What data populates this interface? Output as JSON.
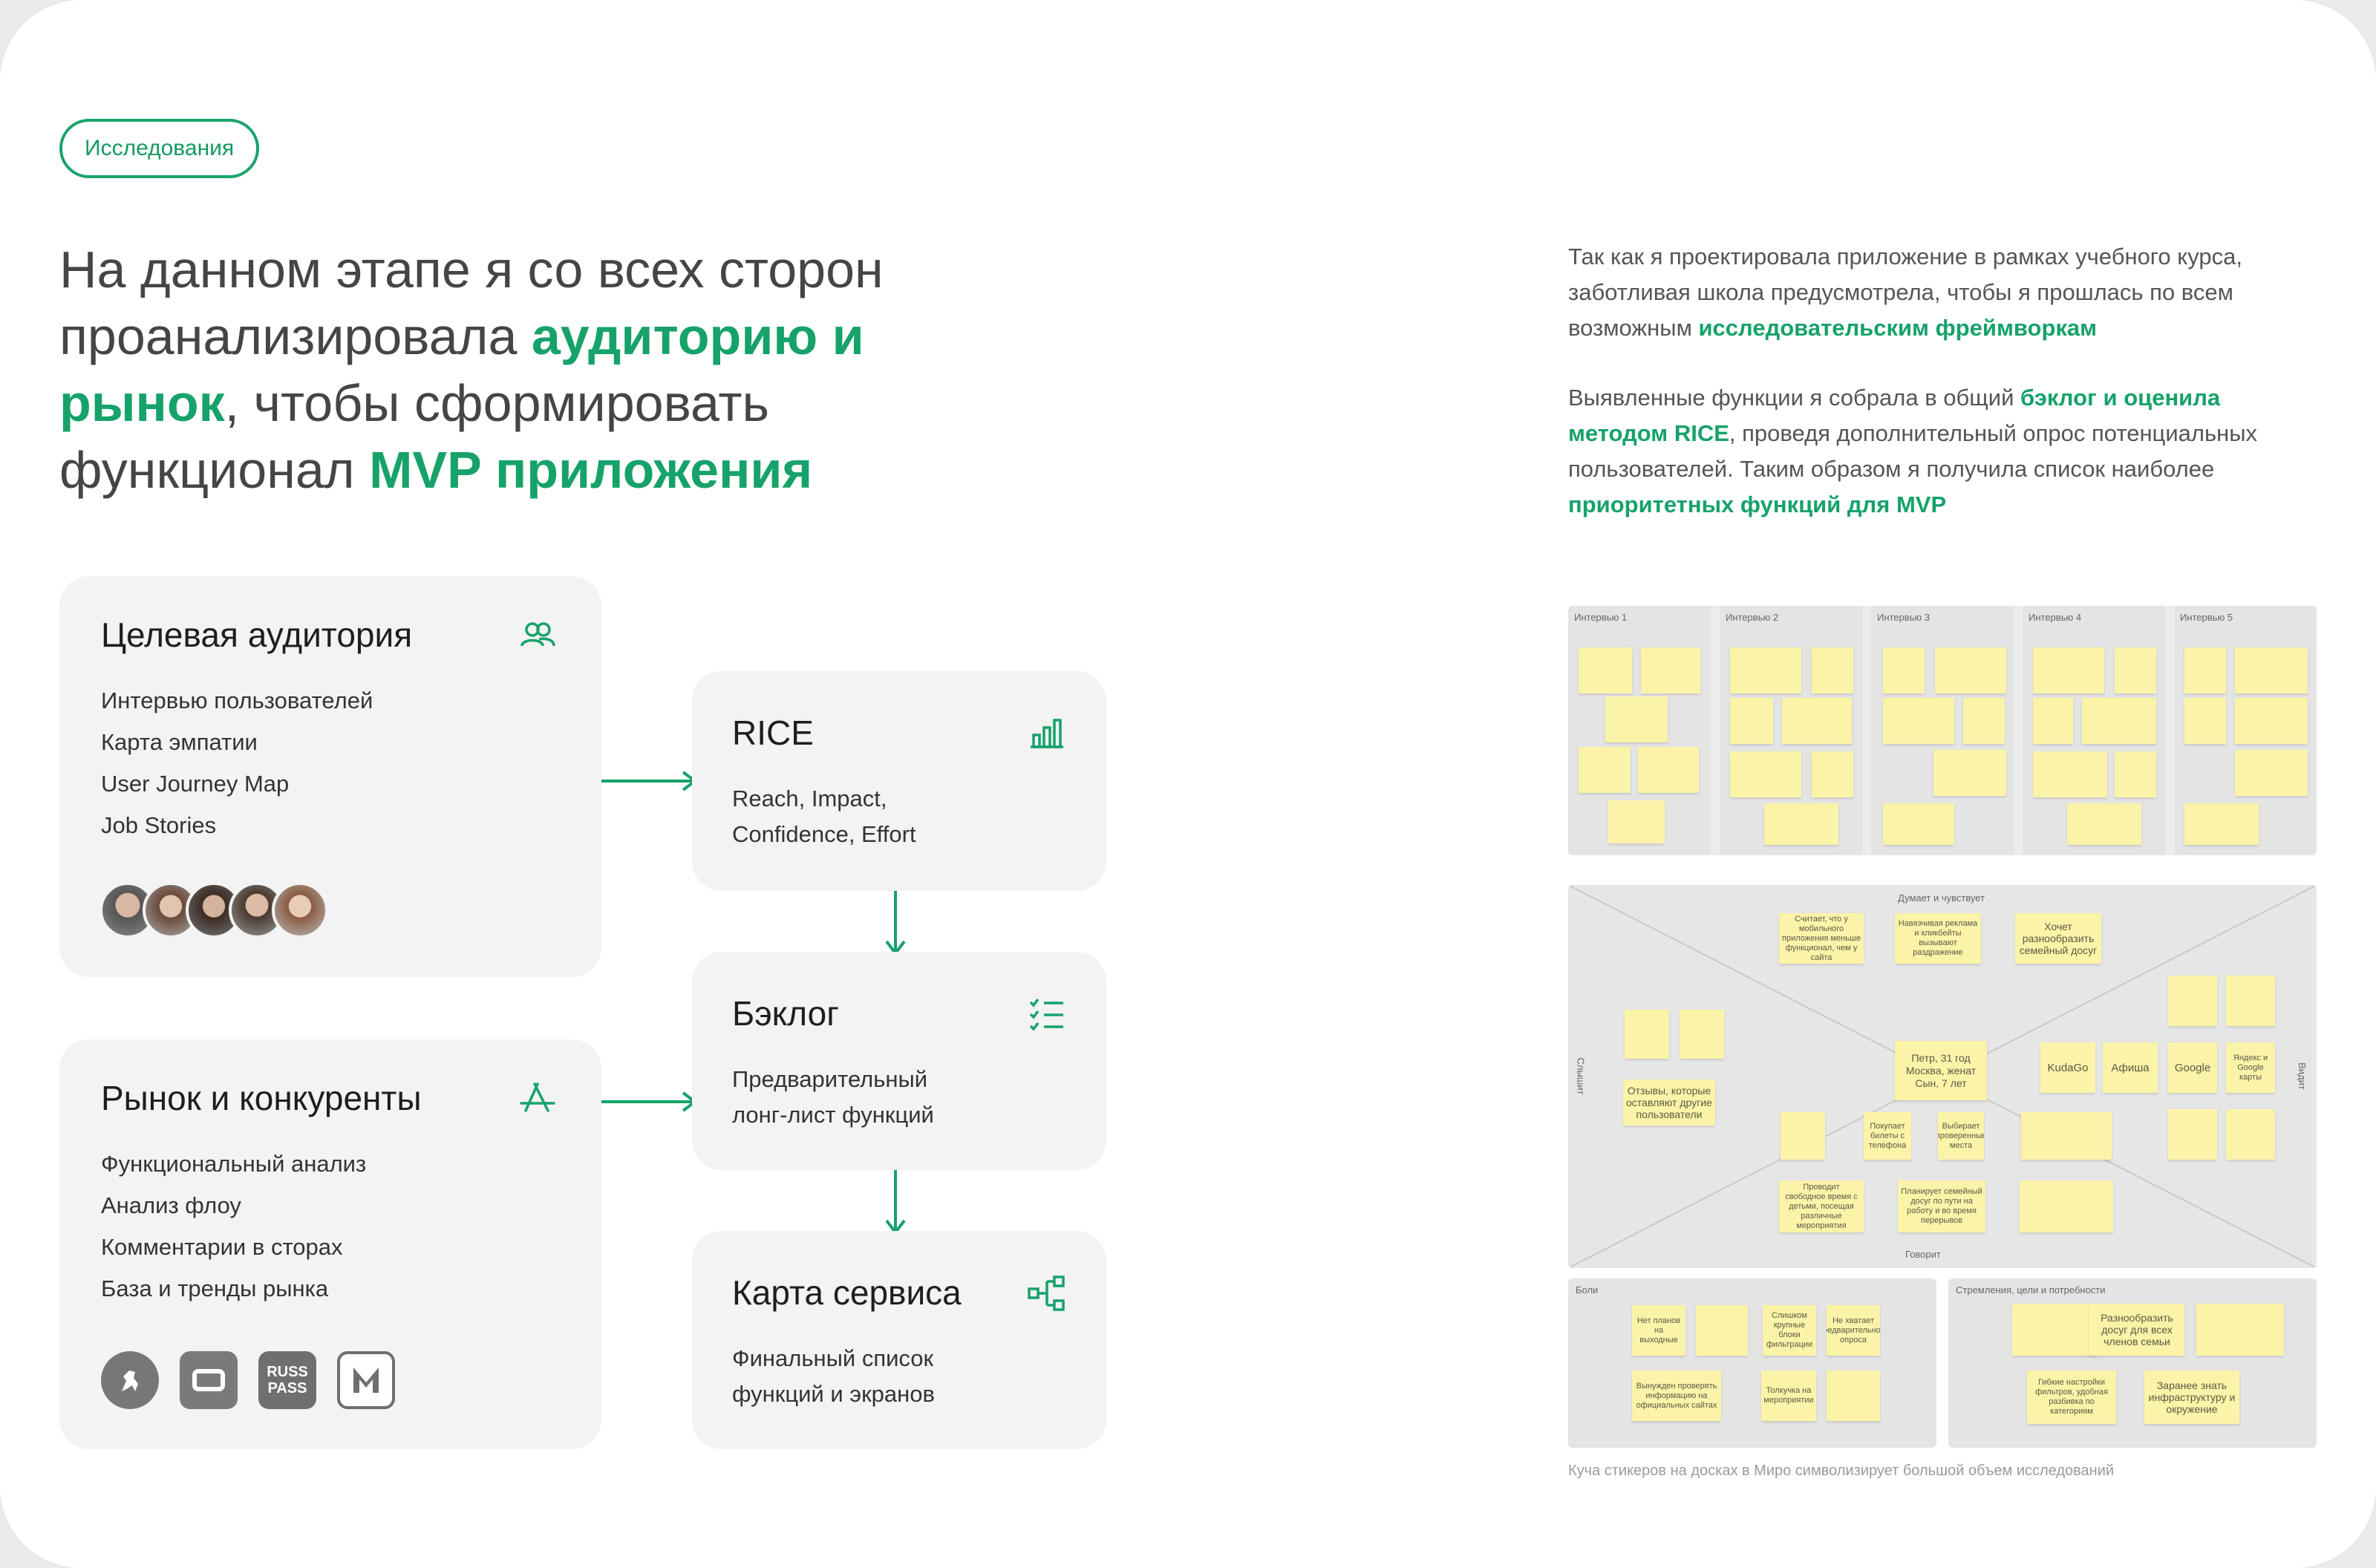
{
  "tag": "Исследования",
  "headline": {
    "part1": "На данном этапе я со всех сторон проанализировала ",
    "em1": "аудиторию и рынок",
    "part2": ", чтобы сформировать функционал ",
    "em2": "MVP приложения"
  },
  "intro": {
    "p1_text": "Так как я проектировала приложение в рамках учебного курса, заботливая школа предусмотрела, чтобы я прошлась по всем возможным ",
    "p1_em": "исследовательским фреймворкам",
    "p2_text1": "Выявленные функции я собрала в общий ",
    "p2_em1": "бэклог и оценила методом RICE",
    "p2_text2": ", проведя дополнительный опрос потенциальных пользователей. Таким образом я получила список наиболее ",
    "p2_em2": "приоритетных функций для MVP"
  },
  "audience": {
    "title": "Целевая аудитория",
    "icon": "users-icon",
    "items": [
      "Интервью пользователей",
      "Карта эмпатии",
      "User Journey Map",
      "Job Stories"
    ]
  },
  "market": {
    "title": "Рынок и конкуренты",
    "icon": "app-store-icon",
    "items": [
      "Функциональный анализ",
      "Анализ флоу",
      "Комментарии в сторах",
      "База и тренды рынка"
    ],
    "logos": [
      "Яндекс Афиша",
      "a",
      "RUSS PASS",
      "M"
    ]
  },
  "rice": {
    "title": "RICE",
    "icon": "bar-chart-icon",
    "desc1": "Reach, Impact,",
    "desc2": "Confidence, Effort"
  },
  "backlog": {
    "title": "Бэклог",
    "icon": "checklist-icon",
    "desc1": "Предварительный",
    "desc2": "лонг-лист функций"
  },
  "service_map": {
    "title": "Карта сервиса",
    "icon": "flow-tree-icon",
    "desc1": "Финальный список",
    "desc2": "функций и экранов"
  },
  "boards": {
    "interviews": [
      "Интервью 1",
      "Интервью 2",
      "Интервью 3",
      "Интервью 4",
      "Интервью 5"
    ],
    "empathy": {
      "top": "Думает и чувствует",
      "bottom": "Говорит",
      "left": "Слышит",
      "right": "Видит",
      "center": "Петр, 31 год Москва, женат Сын, 7 лет",
      "stickers": [
        "Хочет разнообразить семейный досуг",
        "Навязчивая реклама и кликбейты вызывают раздражение",
        "Считает, что у мобильного приложения меньше функционал, чем у сайта",
        "KudaGo",
        "Афиша",
        "Google",
        "Яндекс и Google карты",
        "Отзывы, которые оставляют другие пользователи",
        "Покупает билеты с телефона",
        "Выбирает проверенные места",
        "Планирует семейный досуг по пути на работу и во время перерывов",
        "Проводит свободное время с детьми, посещая различные мероприятия"
      ]
    },
    "pains": {
      "title": "Боли",
      "stickers": [
        "Нет планов на выходные",
        "Слишком крупные блоки фильтрации",
        "Не хватает предварительного опроса",
        "Вынужден проверять информацию на официальных сайтах",
        "Толкучка на мероприятии"
      ]
    },
    "goals": {
      "title": "Стремления, цели и потребности",
      "stickers": [
        "Разнообразить досуг для всех членов семьи",
        "Гибкие настройки фильтров, удобная разбивка по категориям",
        "Заранее знать инфраструктуру и окружение"
      ]
    }
  },
  "caption": "Куча стикеров на досках в Миро символизирует большой объем исследований"
}
